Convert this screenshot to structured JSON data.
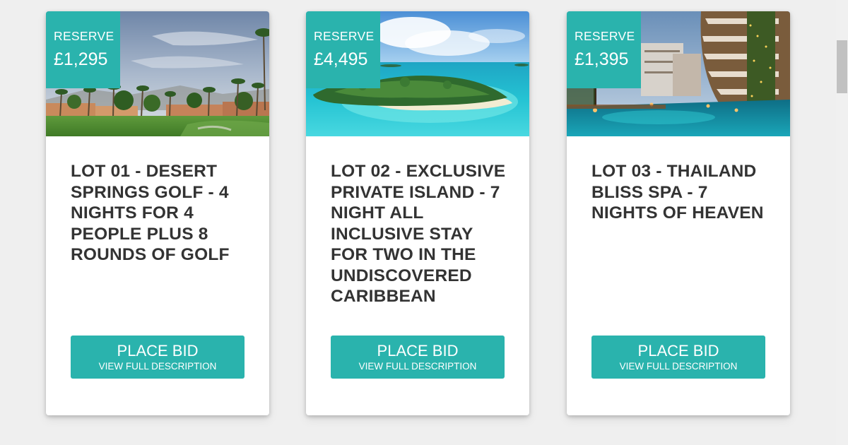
{
  "lots": [
    {
      "reserve_label": "RESERVE",
      "reserve_price": "£1,295",
      "title": "LOT 01 - DESERT SPRINGS GOLF - 4 NIGHTS FOR 4 PEOPLE PLUS 8 ROUNDS OF GOLF",
      "bid_label": "PLACE BID",
      "description_label": "VIEW FULL DESCRIPTION"
    },
    {
      "reserve_label": "RESERVE",
      "reserve_price": "£4,495",
      "title": "LOT 02 - EXCLUSIVE PRIVATE ISLAND - 7 NIGHT ALL INCLUSIVE STAY FOR TWO IN THE UNDISCOVERED CARIBBEAN",
      "bid_label": "PLACE BID",
      "description_label": "VIEW FULL DESCRIPTION"
    },
    {
      "reserve_label": "RESERVE",
      "reserve_price": "£1,395",
      "title": "LOT 03 - THAILAND BLISS SPA - 7 NIGHTS OF HEAVEN",
      "bid_label": "PLACE BID",
      "description_label": "VIEW FULL DESCRIPTION"
    }
  ],
  "colors": {
    "accent": "#2ab3ad",
    "page_background": "#efefef",
    "card_background": "#ffffff",
    "title_text": "#333333"
  },
  "icons": {
    "scrollbar": "vertical-scrollbar"
  }
}
